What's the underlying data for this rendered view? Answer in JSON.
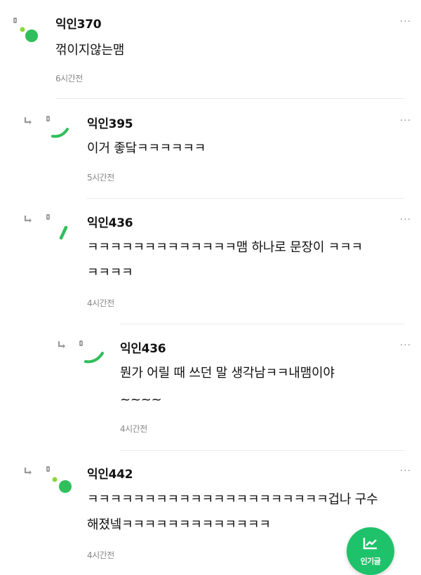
{
  "comments": [
    {
      "author": "익인370",
      "body": "꺾이지않는맴",
      "time": "6시간전",
      "more": "···",
      "avatar": "dot-avatar",
      "reply": false
    },
    {
      "author": "익인395",
      "body": "이거 좋닼ㅋㅋㅋㅋㅋㅋ",
      "time": "5시간전",
      "more": "···",
      "avatar": "arc-avatar",
      "reply": true
    },
    {
      "author": "익인436",
      "body_lines": [
        "ㅋㅋㅋㅋㅋㅋㅋㅋㅋㅋㅋㅋㅋ맴 하나로 문장이 ㅋㅋㅋ",
        "ㅋㅋㅋㅋ"
      ],
      "time": "4시간전",
      "more": "···",
      "avatar": "slash-avatar",
      "reply": true
    },
    {
      "author": "익인436",
      "body_lines": [
        "뭔가 어릴 때 쓰던 말 생각남ㅋㅋ내맴이야",
        "~~~~"
      ],
      "time": "4시간전",
      "more": "···",
      "avatar": "arc-avatar",
      "reply": true
    },
    {
      "author": "익인442",
      "body_lines": [
        "ㅋㅋㅋㅋㅋㅋㅋㅋㅋㅋㅋㅋㅋㅋㅋㅋㅋㅋㅋㅋㅋ겁나 구수",
        "해졌넼ㅋㅋㅋㅋㅋㅋㅋㅋㅋㅋㅋㅋㅋ"
      ],
      "time": "4시간전",
      "more": "···",
      "avatar": "dot-avatar",
      "reply": true
    }
  ],
  "fab": {
    "label": "인기글",
    "icon": "trending-chart-icon"
  },
  "colors": {
    "accent": "#1ec26a",
    "avatar_green": "#2fbf5b",
    "avatar_light": "#8bd93a"
  }
}
